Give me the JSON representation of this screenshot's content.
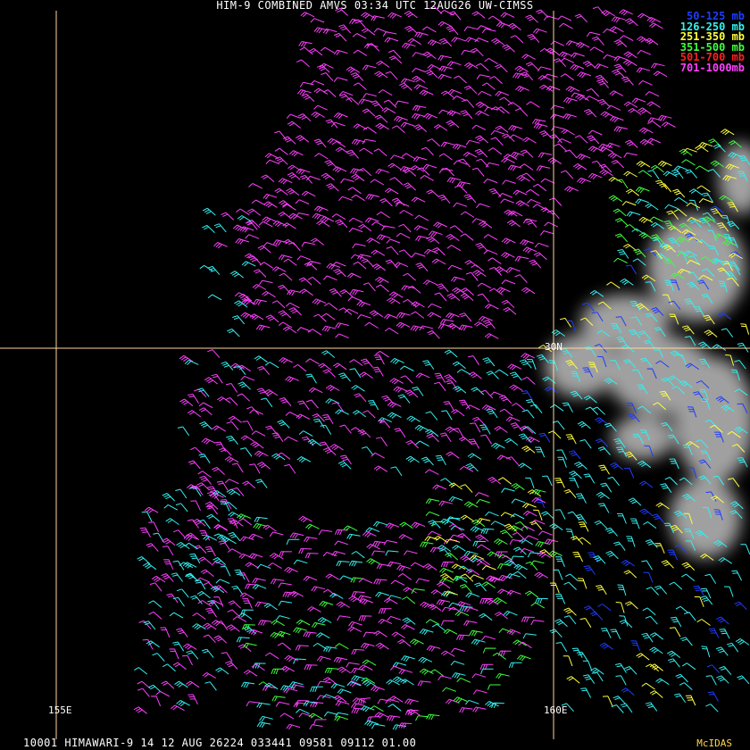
{
  "title": "HIM-9 COMBINED AMVS 03:34 UTC 12AUG26 UW-CIMSS",
  "legend": [
    {
      "label": "50-125 mb",
      "color": "#1f3cff"
    },
    {
      "label": "126-250 mb",
      "color": "#35f0f0"
    },
    {
      "label": "251-350 mb",
      "color": "#ffff40"
    },
    {
      "label": "351-500 mb",
      "color": "#40ff40"
    },
    {
      "label": "501-700 mb",
      "color": "#ff2020"
    },
    {
      "label": "701-1000mb",
      "color": "#ff40ff"
    }
  ],
  "grid": {
    "lat_label": "30N",
    "lon_labels": [
      "155E",
      "160E"
    ],
    "grid_color": "#ffd6a0"
  },
  "footer": "10001 HIMAWARI-9 14 12 AUG 26224 033441 09581 09112 01.00",
  "brand": "McIDAS"
}
